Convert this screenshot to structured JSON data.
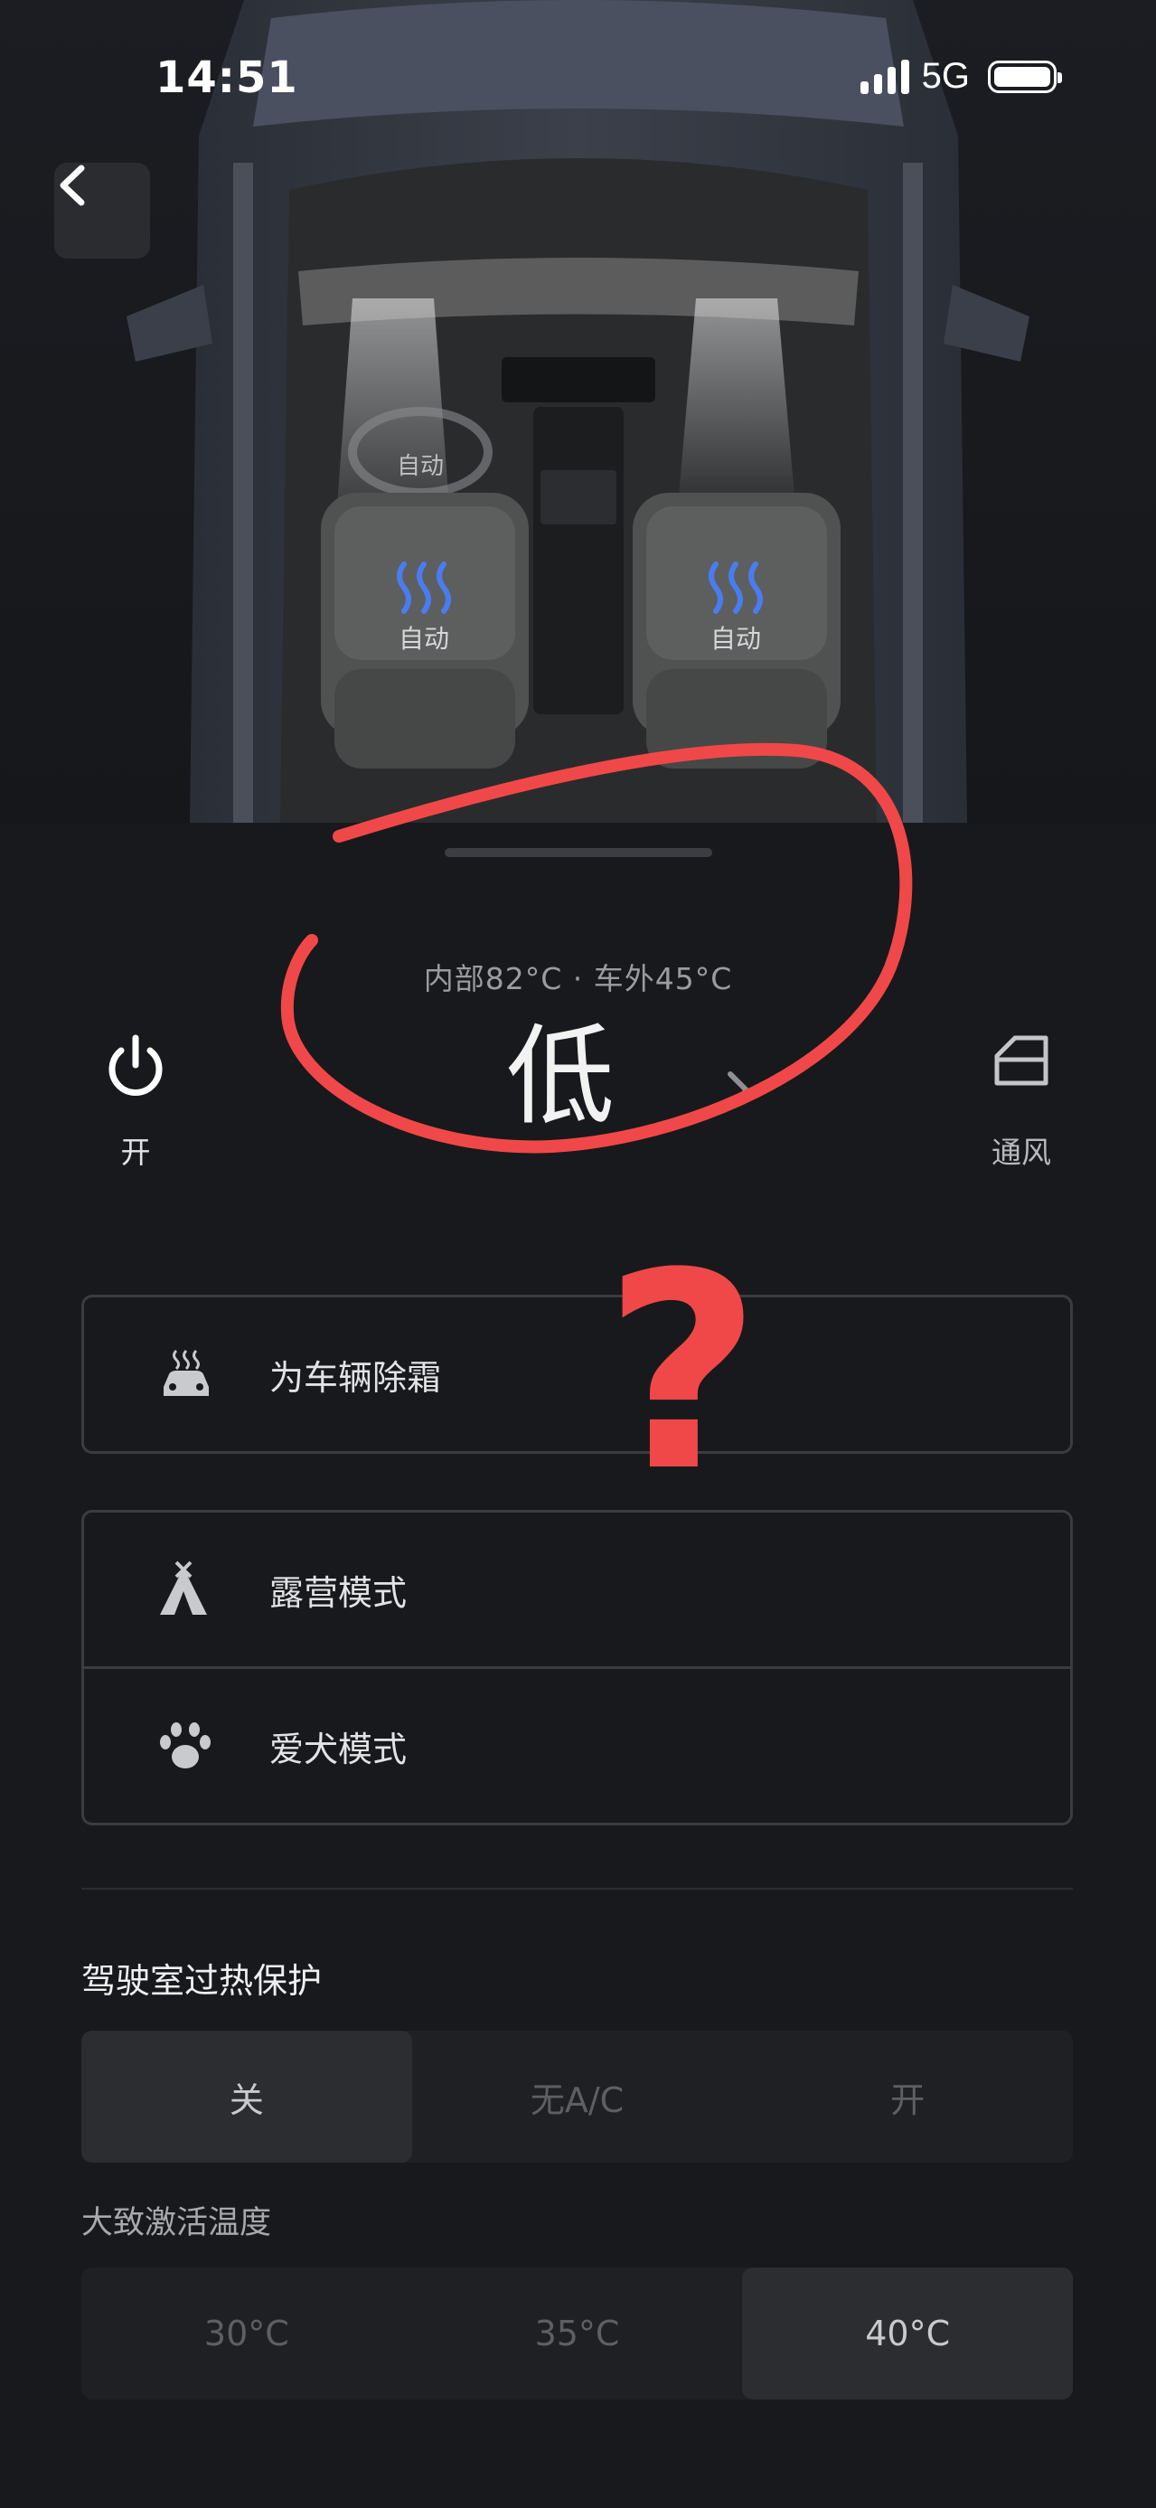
{
  "status_bar": {
    "time": "14:51",
    "network": "5G"
  },
  "car_view": {
    "steering_mode": "自动",
    "left_seat_mode": "自动",
    "right_seat_mode": "自动",
    "heat_color": "#4a7cf0"
  },
  "climate": {
    "temperature_line": "内部82°C · 车外45°C",
    "power_label": "开",
    "fan_level": "低",
    "vent_label": "通风"
  },
  "options": {
    "defrost_label": "为车辆除霜",
    "camp_mode_label": "露营模式",
    "dog_mode_label": "爱犬模式"
  },
  "overheat_protection": {
    "title": "驾驶室过热保护",
    "modes": [
      "关",
      "无A/C",
      "开"
    ],
    "selected_mode": "关",
    "activation_label": "大致激活温度",
    "temps": [
      "30°C",
      "35°C",
      "40°C"
    ],
    "selected_temp": "40°C"
  },
  "annotation": {
    "symbol": "?",
    "color": "#f04848"
  }
}
